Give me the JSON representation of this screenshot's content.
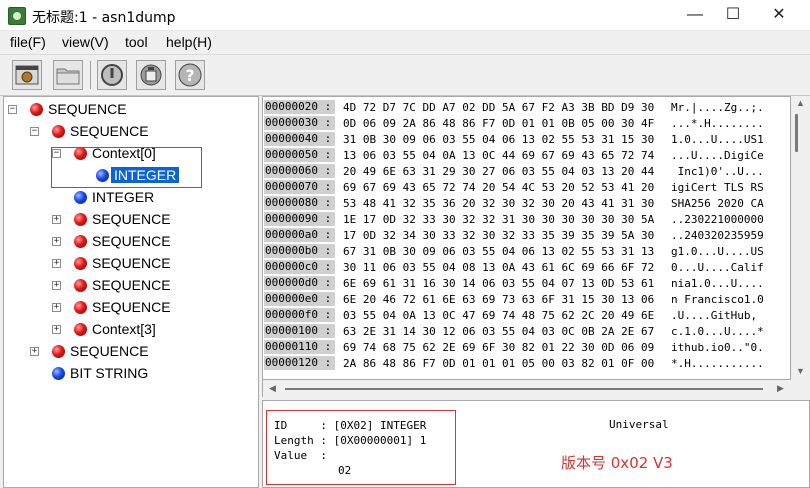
{
  "window": {
    "title": "无标题:1 - asn1dump",
    "minimize": "—",
    "maximize": "☐",
    "close": "✕"
  },
  "menu": {
    "items": [
      "file(F)",
      "view(V)",
      "tool",
      "help(H)"
    ]
  },
  "toolbar": {
    "icons": [
      "open-window-icon",
      "folder-icon",
      "power-icon",
      "clear-icon",
      "help-icon"
    ]
  },
  "tree": {
    "nodes": [
      {
        "label": "SEQUENCE",
        "color": "red",
        "expander": "minus"
      },
      {
        "label": "SEQUENCE",
        "color": "red",
        "expander": "minus"
      },
      {
        "label": "Context[0]",
        "color": "red",
        "expander": "minus"
      },
      {
        "label": "INTEGER",
        "color": "blue",
        "expander": "",
        "selected": true
      },
      {
        "label": "INTEGER",
        "color": "blue",
        "expander": ""
      },
      {
        "label": "SEQUENCE",
        "color": "red",
        "expander": "plus"
      },
      {
        "label": "SEQUENCE",
        "color": "red",
        "expander": "plus"
      },
      {
        "label": "SEQUENCE",
        "color": "red",
        "expander": "plus"
      },
      {
        "label": "SEQUENCE",
        "color": "red",
        "expander": "plus"
      },
      {
        "label": "SEQUENCE",
        "color": "red",
        "expander": "plus"
      },
      {
        "label": "Context[3]",
        "color": "red",
        "expander": "plus"
      },
      {
        "label": "SEQUENCE",
        "color": "red",
        "expander": "plus"
      },
      {
        "label": "BIT STRING",
        "color": "blue",
        "expander": ""
      }
    ]
  },
  "hex": {
    "rows": [
      {
        "offset": "00000020 :",
        "bytes": "4D 72 D7 7C DD A7 02 DD 5A 67 F2 A3 3B BD D9 30",
        "ascii": "Mr.|....Zg..;."
      },
      {
        "offset": "00000030 :",
        "bytes": "0D 06 09 2A 86 48 86 F7 0D 01 01 0B 05 00 30 4F",
        "ascii": "...*.H........"
      },
      {
        "offset": "00000040 :",
        "bytes": "31 0B 30 09 06 03 55 04 06 13 02 55 53 31 15 30",
        "ascii": "1.0...U....US1"
      },
      {
        "offset": "00000050 :",
        "bytes": "13 06 03 55 04 0A 13 0C 44 69 67 69 43 65 72 74",
        "ascii": "...U....DigiCe"
      },
      {
        "offset": "00000060 :",
        "bytes": "20 49 6E 63 31 29 30 27 06 03 55 04 03 13 20 44",
        "ascii": " Inc1)0'..U..."
      },
      {
        "offset": "00000070 :",
        "bytes": "69 67 69 43 65 72 74 20 54 4C 53 20 52 53 41 20",
        "ascii": "igiCert TLS RS"
      },
      {
        "offset": "00000080 :",
        "bytes": "53 48 41 32 35 36 20 32 30 32 30 20 43 41 31 30",
        "ascii": "SHA256 2020 CA"
      },
      {
        "offset": "00000090 :",
        "bytes": "1E 17 0D 32 33 30 32 32 31 30 30 30 30 30 30 5A",
        "ascii": "..230221000000"
      },
      {
        "offset": "000000a0 :",
        "bytes": "17 0D 32 34 30 33 32 30 32 33 35 39 35 39 5A 30",
        "ascii": "..240320235959"
      },
      {
        "offset": "000000b0 :",
        "bytes": "67 31 0B 30 09 06 03 55 04 06 13 02 55 53 31 13",
        "ascii": "g1.0...U....US"
      },
      {
        "offset": "000000c0 :",
        "bytes": "30 11 06 03 55 04 08 13 0A 43 61 6C 69 66 6F 72",
        "ascii": "0...U....Calif"
      },
      {
        "offset": "000000d0 :",
        "bytes": "6E 69 61 31 16 30 14 06 03 55 04 07 13 0D 53 61",
        "ascii": "nia1.0...U...."
      },
      {
        "offset": "000000e0 :",
        "bytes": "6E 20 46 72 61 6E 63 69 73 63 6F 31 15 30 13 06",
        "ascii": "n Francisco1.0"
      },
      {
        "offset": "000000f0 :",
        "bytes": "03 55 04 0A 13 0C 47 69 74 48 75 62 2C 20 49 6E",
        "ascii": ".U....GitHub, "
      },
      {
        "offset": "00000100 :",
        "bytes": "63 2E 31 14 30 12 06 03 55 04 03 0C 0B 2A 2E 67",
        "ascii": "c.1.0...U....*"
      },
      {
        "offset": "00000110 :",
        "bytes": "69 74 68 75 62 2E 69 6F 30 82 01 22 30 0D 06 09",
        "ascii": "ithub.io0..\"0."
      },
      {
        "offset": "00000120 :",
        "bytes": "2A 86 48 86 F7 0D 01 01 01 05 00 03 82 01 0F 00",
        "ascii": "*.H..........."
      }
    ]
  },
  "info": {
    "id_line": "ID     : [0X02] INTEGER",
    "length_line": "Length : [0X00000001] 1",
    "value_line": "Value  :",
    "value": "02",
    "class": "Universal",
    "annotation": "版本号 0x02  V3"
  },
  "colors": {
    "selection": "#0a64d8",
    "highlight_box": "#e03030",
    "annotation": "#e03030"
  }
}
